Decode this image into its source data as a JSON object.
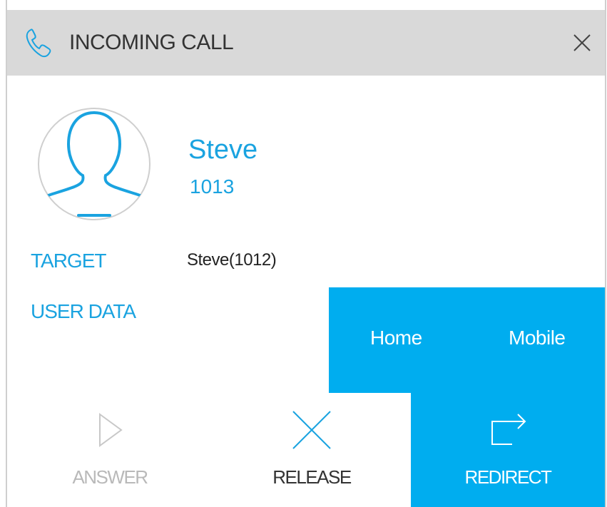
{
  "window": {
    "title": "INCOMING CALL"
  },
  "caller": {
    "name": "Steve",
    "number": "1013"
  },
  "details": {
    "target_label": "TARGET",
    "target_value": "Steve(1012)",
    "user_data_label": "USER DATA"
  },
  "redirect_options": [
    {
      "label": "Home"
    },
    {
      "label": "Mobile"
    }
  ],
  "actions": {
    "answer": {
      "label": "ANSWER",
      "enabled": false
    },
    "release": {
      "label": "RELEASE"
    },
    "redirect": {
      "label": "REDIRECT"
    }
  },
  "icons": {
    "title": "phone-icon",
    "close": "close-icon",
    "avatar": "user-avatar-icon",
    "answer": "play-triangle-icon",
    "release": "x-icon",
    "redirect": "redirect-arrow-icon"
  },
  "colors": {
    "accent": "#00adef",
    "label": "#1aa3e0",
    "titlebar": "#d9d9d9",
    "disabled": "#b9b9b9"
  }
}
